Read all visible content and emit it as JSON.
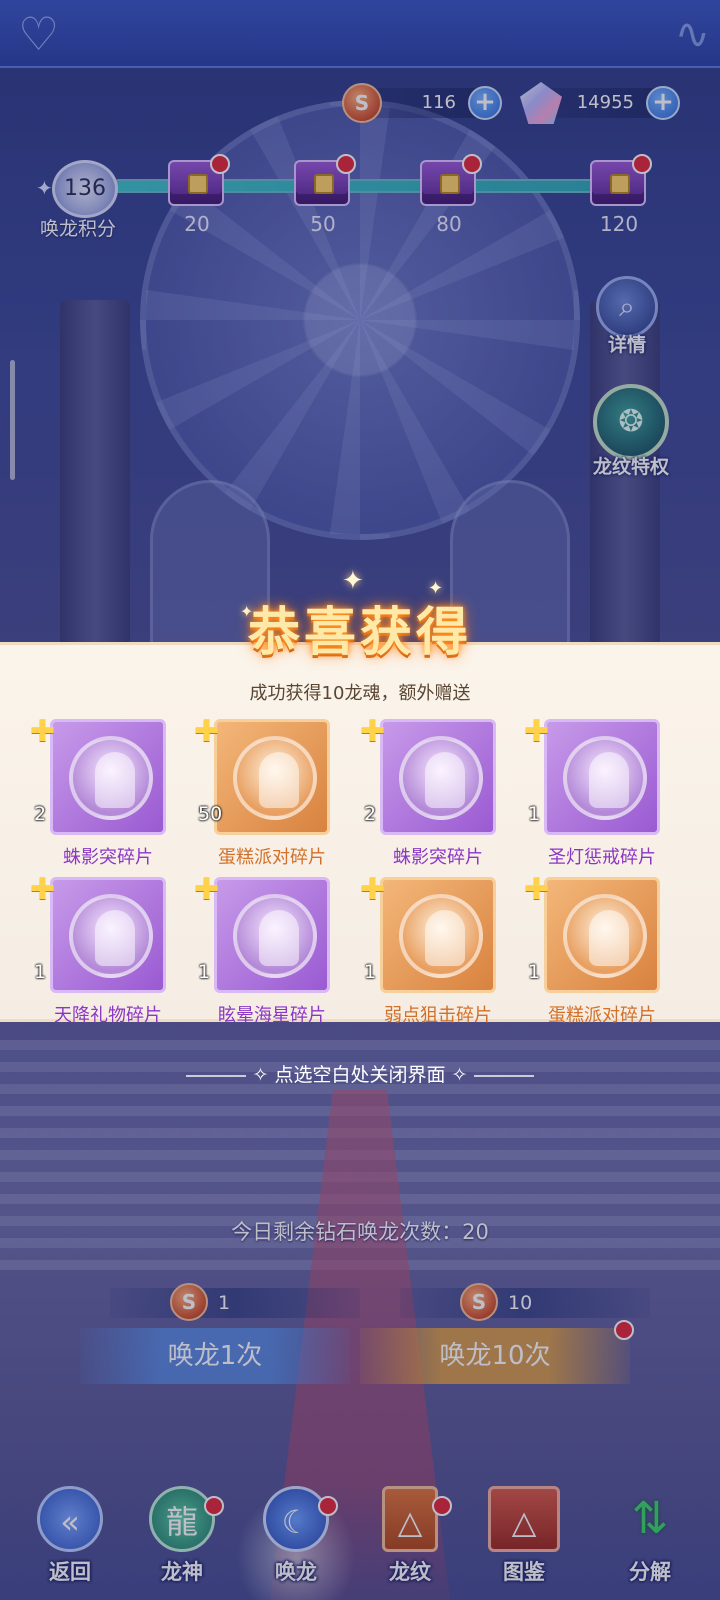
{
  "currency": {
    "coin_icon": "S",
    "coin_amount": "116",
    "gem_amount": "14955"
  },
  "summon_points": {
    "value": "136",
    "label": "唤龙积分",
    "progress_fraction": 1.0,
    "milestones": [
      "20",
      "50",
      "80",
      "120"
    ]
  },
  "side_buttons": {
    "details": "详情",
    "privilege": "龙纹特权"
  },
  "popup": {
    "title": "恭喜获得",
    "subtitle": "成功获得10龙魂，额外赠送",
    "items": [
      {
        "name": "蛛影突碎片",
        "qty": "2",
        "rarity": "purple"
      },
      {
        "name": "蛋糕派对碎片",
        "qty": "50",
        "rarity": "orange"
      },
      {
        "name": "蛛影突碎片",
        "qty": "2",
        "rarity": "purple"
      },
      {
        "name": "圣灯惩戒碎片",
        "qty": "1",
        "rarity": "purple"
      },
      {
        "name": "天降礼物碎片",
        "qty": "1",
        "rarity": "purple"
      },
      {
        "name": "眩晕海星碎片",
        "qty": "1",
        "rarity": "purple"
      },
      {
        "name": "弱点狙击碎片",
        "qty": "1",
        "rarity": "orange"
      },
      {
        "name": "蛋糕派对碎片",
        "qty": "1",
        "rarity": "orange"
      }
    ],
    "close_hint": "点选空白处关闭界面"
  },
  "summon": {
    "remaining": "今日剩余钻石唤龙次数：20",
    "single_cost": "1",
    "ten_cost": "10",
    "single_label": "唤龙1次",
    "ten_label": "唤龙10次"
  },
  "nav": {
    "back": "返回",
    "dragon_god": "龙神",
    "summon": "唤龙",
    "pattern": "龙纹",
    "atlas": "图鉴",
    "decompose": "分解"
  },
  "colors": {
    "purple_rarity": "#9a5ad2",
    "orange_rarity": "#d9823f",
    "notification_dot": "#e22a3a"
  }
}
